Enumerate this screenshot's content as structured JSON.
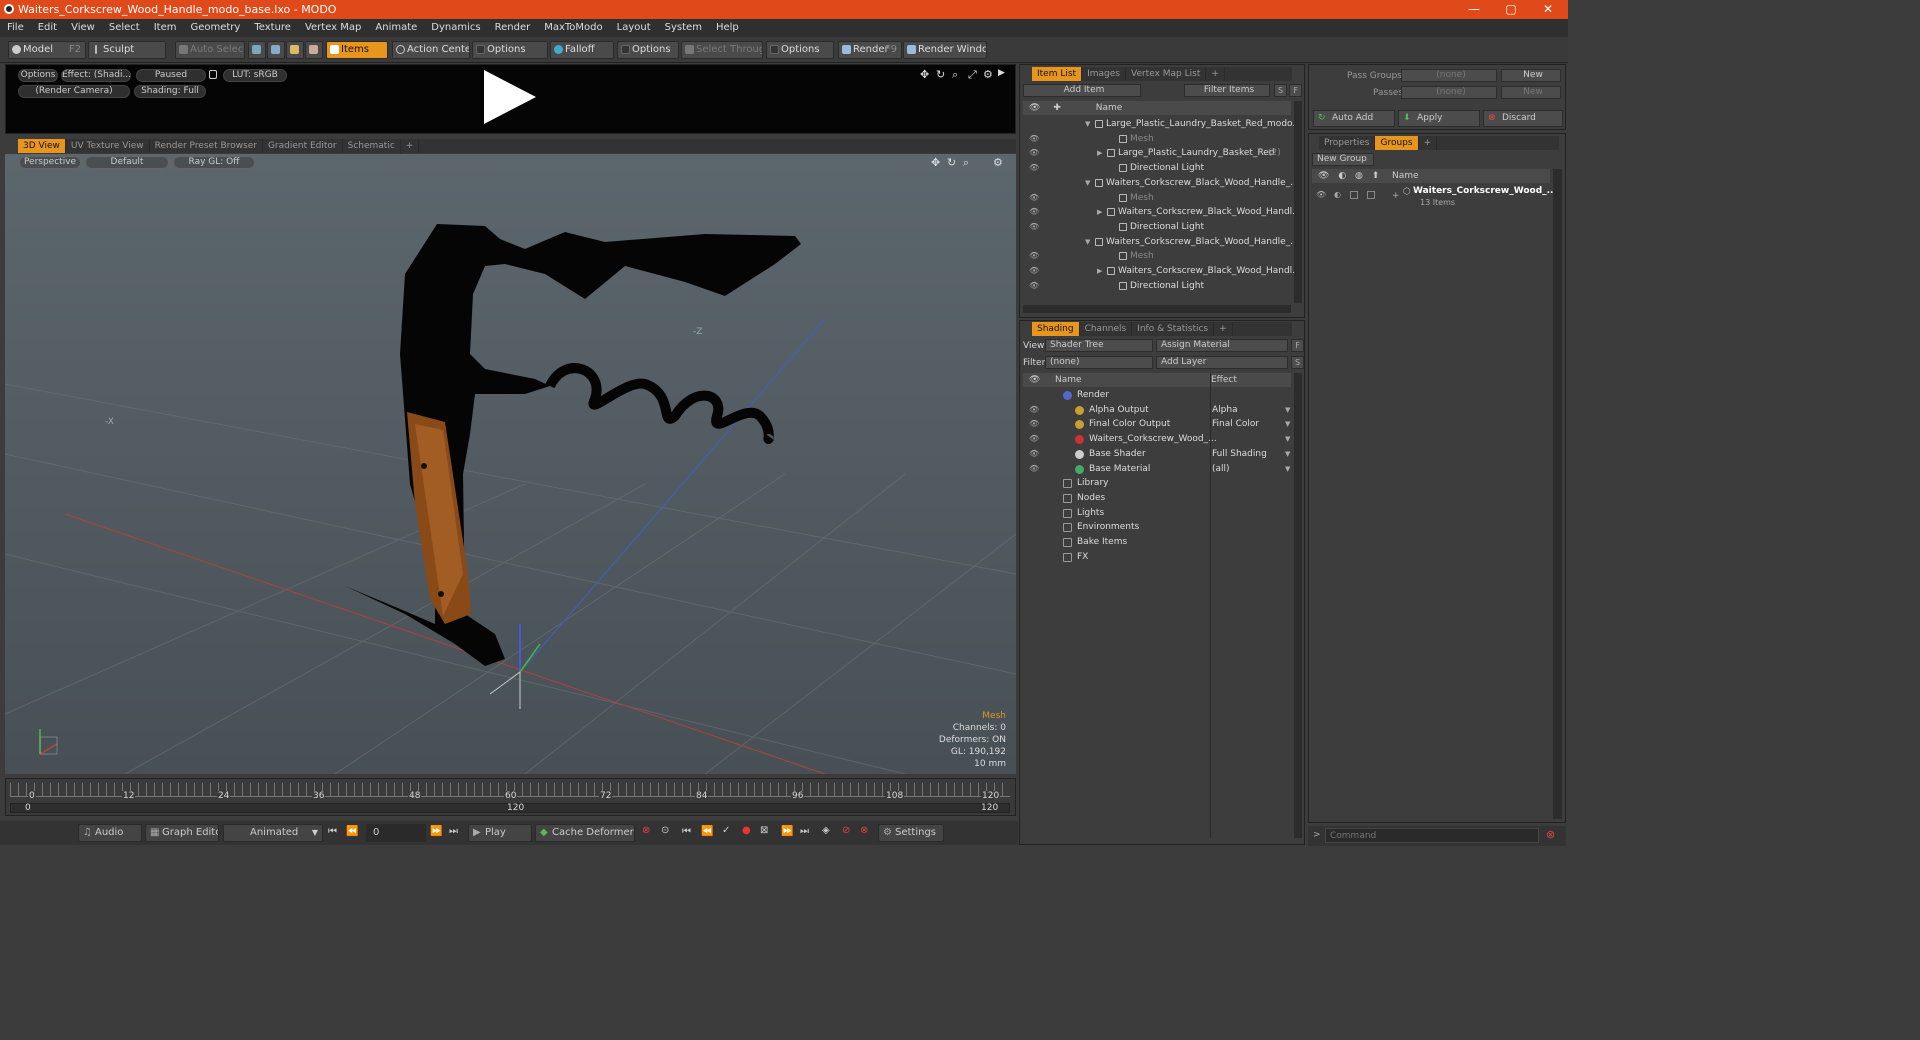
{
  "window": {
    "title": "Waiters_Corkscrew_Wood_Handle_modo_base.lxo - MODO",
    "minimize": "—",
    "maximize": "▢",
    "close": "✕"
  },
  "menu": [
    "File",
    "Edit",
    "View",
    "Select",
    "Item",
    "Geometry",
    "Texture",
    "Vertex Map",
    "Animate",
    "Dynamics",
    "Render",
    "MaxToModo",
    "Layout",
    "System",
    "Help"
  ],
  "toolbar": {
    "model": "Model",
    "model_key": "F2",
    "sculpt": "Sculpt",
    "auto_select": "Auto Select",
    "items": "Items",
    "action_center": "Action Center",
    "options1": "Options",
    "falloff": "Falloff",
    "options2": "Options",
    "select_through": "Select Through",
    "options3": "Options",
    "render": "Render",
    "render_key": "F9",
    "render_window": "Render Window"
  },
  "render_preview": {
    "options": "Options",
    "effect": "Effect: (Shadi...",
    "paused": "Paused",
    "lut": "LUT: sRGB",
    "camera": "(Render Camera)",
    "shading": "Shading: Full"
  },
  "view_tabs": [
    "3D View",
    "UV Texture View",
    "Render Preset Browser",
    "Gradient Editor",
    "Schematic",
    "+"
  ],
  "viewport": {
    "perspective": "Perspective",
    "default": "Default",
    "raygl": "Ray GL: Off",
    "axis_neg_z": "-Z",
    "axis_neg_x": "-X"
  },
  "readout": {
    "mesh": "Mesh",
    "channels": "Channels: 0",
    "deformers": "Deformers: ON",
    "gl": "GL: 190,192",
    "unit": "10 mm"
  },
  "timeline": {
    "ticks": [
      "0",
      "12",
      "24",
      "36",
      "48",
      "60",
      "72",
      "84",
      "96",
      "108",
      "120"
    ],
    "start": "0",
    "mid": "120",
    "end": "120"
  },
  "bottom": {
    "audio": "Audio",
    "graph_editor": "Graph Editor",
    "animated": "Animated",
    "frame": "0",
    "play": "Play",
    "cache": "Cache Deformers",
    "settings": "Settings"
  },
  "item_list": {
    "tabs": [
      "Item List",
      "Images",
      "Vertex Map List",
      "+"
    ],
    "add_item": "Add Item",
    "filter": "Filter Items",
    "col_name": "Name",
    "s": "S",
    "f": "F",
    "rows": [
      {
        "label": "Large_Plastic_Laundry_Basket_Red_modo...",
        "indent": 0,
        "dim": false,
        "arrow": "▼"
      },
      {
        "label": "Mesh",
        "indent": 2,
        "dim": true,
        "arrow": ""
      },
      {
        "label": "Large_Plastic_Laundry_Basket_Red",
        "suffix": "(2)",
        "indent": 1,
        "dim": false,
        "arrow": "▶"
      },
      {
        "label": "Directional Light",
        "indent": 2,
        "dim": false,
        "arrow": ""
      },
      {
        "label": "Waiters_Corkscrew_Black_Wood_Handle_...",
        "indent": 0,
        "dim": false,
        "arrow": "▼"
      },
      {
        "label": "Mesh",
        "indent": 2,
        "dim": true,
        "arrow": ""
      },
      {
        "label": "Waiters_Corkscrew_Black_Wood_Handl...",
        "indent": 1,
        "dim": false,
        "arrow": "▶"
      },
      {
        "label": "Directional Light",
        "indent": 2,
        "dim": false,
        "arrow": ""
      },
      {
        "label": "Waiters_Corkscrew_Black_Wood_Handle_...",
        "indent": 0,
        "dim": false,
        "arrow": "▼"
      },
      {
        "label": "Mesh",
        "indent": 2,
        "dim": true,
        "arrow": ""
      },
      {
        "label": "Waiters_Corkscrew_Black_Wood_Handl...",
        "indent": 1,
        "dim": false,
        "arrow": "▶"
      },
      {
        "label": "Directional Light",
        "indent": 2,
        "dim": false,
        "arrow": ""
      }
    ]
  },
  "shading": {
    "tabs": [
      "Shading",
      "Channels",
      "Info & Statistics",
      "+"
    ],
    "view_label": "View",
    "view_value": "Shader Tree",
    "assign": "Assign Material",
    "filter_label": "Filter",
    "filter_value": "(none)",
    "add_layer": "Add Layer",
    "f": "F",
    "s": "S",
    "col_name": "Name",
    "col_effect": "Effect",
    "rows": [
      {
        "label": "Render",
        "effect": "",
        "indent": 1,
        "color": "#5566cc"
      },
      {
        "label": "Alpha Output",
        "effect": "Alpha",
        "indent": 2,
        "color": "#c8a030"
      },
      {
        "label": "Final Color Output",
        "effect": "Final Color",
        "indent": 2,
        "color": "#c8a030"
      },
      {
        "label": "Waiters_Corkscrew_Wood_...",
        "effect": "",
        "indent": 2,
        "color": "#cc3333"
      },
      {
        "label": "Base Shader",
        "effect": "Full Shading",
        "indent": 2,
        "color": "#cccccc"
      },
      {
        "label": "Base Material",
        "effect": "(all)",
        "indent": 2,
        "color": "#44aa66"
      },
      {
        "label": "Library",
        "effect": "",
        "indent": 0,
        "color": ""
      },
      {
        "label": "Nodes",
        "effect": "",
        "indent": 0,
        "color": ""
      },
      {
        "label": "Lights",
        "effect": "",
        "indent": 0,
        "color": ""
      },
      {
        "label": "Environments",
        "effect": "",
        "indent": 0,
        "color": ""
      },
      {
        "label": "Bake Items",
        "effect": "",
        "indent": 0,
        "color": ""
      },
      {
        "label": "FX",
        "effect": "",
        "indent": 0,
        "color": ""
      }
    ]
  },
  "groups": {
    "pass_groups": "Pass Groups",
    "pass_val": "(none)",
    "passes": "Passes",
    "passes_val": "(none)",
    "new1": "New",
    "new2": "New",
    "auto_add": "Auto Add",
    "apply": "Apply",
    "discard": "Discard",
    "tabs": [
      "Properties",
      "Groups",
      "+"
    ],
    "new_group": "New Group",
    "col_name": "Name",
    "item": "Waiters_Corkscrew_Wood_...",
    "count": "13 Items"
  },
  "command": {
    "placeholder": "Command"
  }
}
